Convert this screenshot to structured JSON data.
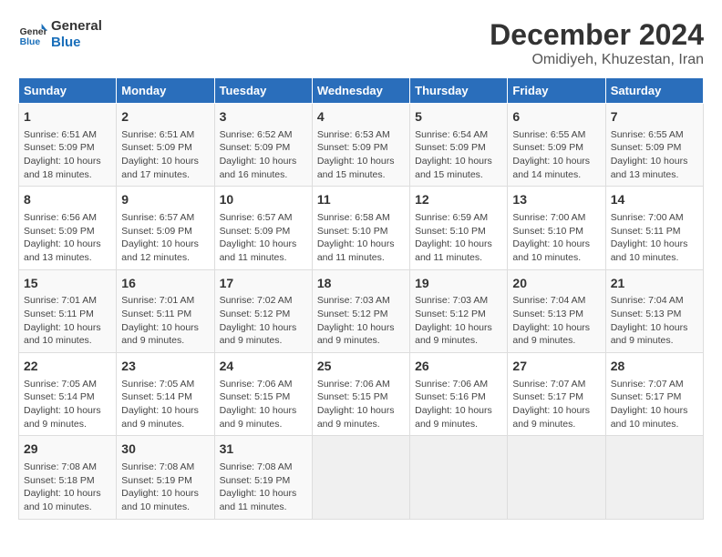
{
  "header": {
    "logo_line1": "General",
    "logo_line2": "Blue",
    "month": "December 2024",
    "location": "Omidiyeh, Khuzestan, Iran"
  },
  "days_of_week": [
    "Sunday",
    "Monday",
    "Tuesday",
    "Wednesday",
    "Thursday",
    "Friday",
    "Saturday"
  ],
  "weeks": [
    [
      {
        "day": "1",
        "info": "Sunrise: 6:51 AM\nSunset: 5:09 PM\nDaylight: 10 hours\nand 18 minutes."
      },
      {
        "day": "2",
        "info": "Sunrise: 6:51 AM\nSunset: 5:09 PM\nDaylight: 10 hours\nand 17 minutes."
      },
      {
        "day": "3",
        "info": "Sunrise: 6:52 AM\nSunset: 5:09 PM\nDaylight: 10 hours\nand 16 minutes."
      },
      {
        "day": "4",
        "info": "Sunrise: 6:53 AM\nSunset: 5:09 PM\nDaylight: 10 hours\nand 15 minutes."
      },
      {
        "day": "5",
        "info": "Sunrise: 6:54 AM\nSunset: 5:09 PM\nDaylight: 10 hours\nand 15 minutes."
      },
      {
        "day": "6",
        "info": "Sunrise: 6:55 AM\nSunset: 5:09 PM\nDaylight: 10 hours\nand 14 minutes."
      },
      {
        "day": "7",
        "info": "Sunrise: 6:55 AM\nSunset: 5:09 PM\nDaylight: 10 hours\nand 13 minutes."
      }
    ],
    [
      {
        "day": "8",
        "info": "Sunrise: 6:56 AM\nSunset: 5:09 PM\nDaylight: 10 hours\nand 13 minutes."
      },
      {
        "day": "9",
        "info": "Sunrise: 6:57 AM\nSunset: 5:09 PM\nDaylight: 10 hours\nand 12 minutes."
      },
      {
        "day": "10",
        "info": "Sunrise: 6:57 AM\nSunset: 5:09 PM\nDaylight: 10 hours\nand 11 minutes."
      },
      {
        "day": "11",
        "info": "Sunrise: 6:58 AM\nSunset: 5:10 PM\nDaylight: 10 hours\nand 11 minutes."
      },
      {
        "day": "12",
        "info": "Sunrise: 6:59 AM\nSunset: 5:10 PM\nDaylight: 10 hours\nand 11 minutes."
      },
      {
        "day": "13",
        "info": "Sunrise: 7:00 AM\nSunset: 5:10 PM\nDaylight: 10 hours\nand 10 minutes."
      },
      {
        "day": "14",
        "info": "Sunrise: 7:00 AM\nSunset: 5:11 PM\nDaylight: 10 hours\nand 10 minutes."
      }
    ],
    [
      {
        "day": "15",
        "info": "Sunrise: 7:01 AM\nSunset: 5:11 PM\nDaylight: 10 hours\nand 10 minutes."
      },
      {
        "day": "16",
        "info": "Sunrise: 7:01 AM\nSunset: 5:11 PM\nDaylight: 10 hours\nand 9 minutes."
      },
      {
        "day": "17",
        "info": "Sunrise: 7:02 AM\nSunset: 5:12 PM\nDaylight: 10 hours\nand 9 minutes."
      },
      {
        "day": "18",
        "info": "Sunrise: 7:03 AM\nSunset: 5:12 PM\nDaylight: 10 hours\nand 9 minutes."
      },
      {
        "day": "19",
        "info": "Sunrise: 7:03 AM\nSunset: 5:12 PM\nDaylight: 10 hours\nand 9 minutes."
      },
      {
        "day": "20",
        "info": "Sunrise: 7:04 AM\nSunset: 5:13 PM\nDaylight: 10 hours\nand 9 minutes."
      },
      {
        "day": "21",
        "info": "Sunrise: 7:04 AM\nSunset: 5:13 PM\nDaylight: 10 hours\nand 9 minutes."
      }
    ],
    [
      {
        "day": "22",
        "info": "Sunrise: 7:05 AM\nSunset: 5:14 PM\nDaylight: 10 hours\nand 9 minutes."
      },
      {
        "day": "23",
        "info": "Sunrise: 7:05 AM\nSunset: 5:14 PM\nDaylight: 10 hours\nand 9 minutes."
      },
      {
        "day": "24",
        "info": "Sunrise: 7:06 AM\nSunset: 5:15 PM\nDaylight: 10 hours\nand 9 minutes."
      },
      {
        "day": "25",
        "info": "Sunrise: 7:06 AM\nSunset: 5:15 PM\nDaylight: 10 hours\nand 9 minutes."
      },
      {
        "day": "26",
        "info": "Sunrise: 7:06 AM\nSunset: 5:16 PM\nDaylight: 10 hours\nand 9 minutes."
      },
      {
        "day": "27",
        "info": "Sunrise: 7:07 AM\nSunset: 5:17 PM\nDaylight: 10 hours\nand 9 minutes."
      },
      {
        "day": "28",
        "info": "Sunrise: 7:07 AM\nSunset: 5:17 PM\nDaylight: 10 hours\nand 10 minutes."
      }
    ],
    [
      {
        "day": "29",
        "info": "Sunrise: 7:08 AM\nSunset: 5:18 PM\nDaylight: 10 hours\nand 10 minutes."
      },
      {
        "day": "30",
        "info": "Sunrise: 7:08 AM\nSunset: 5:19 PM\nDaylight: 10 hours\nand 10 minutes."
      },
      {
        "day": "31",
        "info": "Sunrise: 7:08 AM\nSunset: 5:19 PM\nDaylight: 10 hours\nand 11 minutes."
      },
      {
        "day": "",
        "info": ""
      },
      {
        "day": "",
        "info": ""
      },
      {
        "day": "",
        "info": ""
      },
      {
        "day": "",
        "info": ""
      }
    ]
  ]
}
